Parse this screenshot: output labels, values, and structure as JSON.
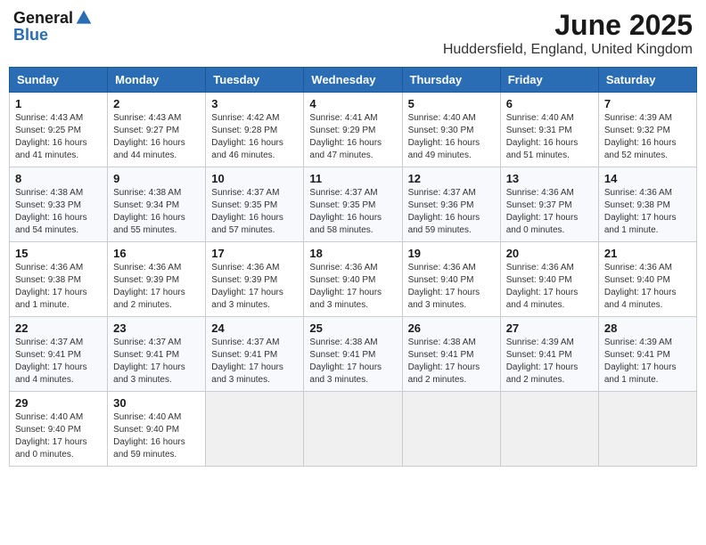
{
  "header": {
    "logo_general": "General",
    "logo_blue": "Blue",
    "month_title": "June 2025",
    "location": "Huddersfield, England, United Kingdom"
  },
  "days_of_week": [
    "Sunday",
    "Monday",
    "Tuesday",
    "Wednesday",
    "Thursday",
    "Friday",
    "Saturday"
  ],
  "weeks": [
    [
      {
        "day": "1",
        "info": "Sunrise: 4:43 AM\nSunset: 9:25 PM\nDaylight: 16 hours and 41 minutes."
      },
      {
        "day": "2",
        "info": "Sunrise: 4:43 AM\nSunset: 9:27 PM\nDaylight: 16 hours and 44 minutes."
      },
      {
        "day": "3",
        "info": "Sunrise: 4:42 AM\nSunset: 9:28 PM\nDaylight: 16 hours and 46 minutes."
      },
      {
        "day": "4",
        "info": "Sunrise: 4:41 AM\nSunset: 9:29 PM\nDaylight: 16 hours and 47 minutes."
      },
      {
        "day": "5",
        "info": "Sunrise: 4:40 AM\nSunset: 9:30 PM\nDaylight: 16 hours and 49 minutes."
      },
      {
        "day": "6",
        "info": "Sunrise: 4:40 AM\nSunset: 9:31 PM\nDaylight: 16 hours and 51 minutes."
      },
      {
        "day": "7",
        "info": "Sunrise: 4:39 AM\nSunset: 9:32 PM\nDaylight: 16 hours and 52 minutes."
      }
    ],
    [
      {
        "day": "8",
        "info": "Sunrise: 4:38 AM\nSunset: 9:33 PM\nDaylight: 16 hours and 54 minutes."
      },
      {
        "day": "9",
        "info": "Sunrise: 4:38 AM\nSunset: 9:34 PM\nDaylight: 16 hours and 55 minutes."
      },
      {
        "day": "10",
        "info": "Sunrise: 4:37 AM\nSunset: 9:35 PM\nDaylight: 16 hours and 57 minutes."
      },
      {
        "day": "11",
        "info": "Sunrise: 4:37 AM\nSunset: 9:35 PM\nDaylight: 16 hours and 58 minutes."
      },
      {
        "day": "12",
        "info": "Sunrise: 4:37 AM\nSunset: 9:36 PM\nDaylight: 16 hours and 59 minutes."
      },
      {
        "day": "13",
        "info": "Sunrise: 4:36 AM\nSunset: 9:37 PM\nDaylight: 17 hours and 0 minutes."
      },
      {
        "day": "14",
        "info": "Sunrise: 4:36 AM\nSunset: 9:38 PM\nDaylight: 17 hours and 1 minute."
      }
    ],
    [
      {
        "day": "15",
        "info": "Sunrise: 4:36 AM\nSunset: 9:38 PM\nDaylight: 17 hours and 1 minute."
      },
      {
        "day": "16",
        "info": "Sunrise: 4:36 AM\nSunset: 9:39 PM\nDaylight: 17 hours and 2 minutes."
      },
      {
        "day": "17",
        "info": "Sunrise: 4:36 AM\nSunset: 9:39 PM\nDaylight: 17 hours and 3 minutes."
      },
      {
        "day": "18",
        "info": "Sunrise: 4:36 AM\nSunset: 9:40 PM\nDaylight: 17 hours and 3 minutes."
      },
      {
        "day": "19",
        "info": "Sunrise: 4:36 AM\nSunset: 9:40 PM\nDaylight: 17 hours and 3 minutes."
      },
      {
        "day": "20",
        "info": "Sunrise: 4:36 AM\nSunset: 9:40 PM\nDaylight: 17 hours and 4 minutes."
      },
      {
        "day": "21",
        "info": "Sunrise: 4:36 AM\nSunset: 9:40 PM\nDaylight: 17 hours and 4 minutes."
      }
    ],
    [
      {
        "day": "22",
        "info": "Sunrise: 4:37 AM\nSunset: 9:41 PM\nDaylight: 17 hours and 4 minutes."
      },
      {
        "day": "23",
        "info": "Sunrise: 4:37 AM\nSunset: 9:41 PM\nDaylight: 17 hours and 3 minutes."
      },
      {
        "day": "24",
        "info": "Sunrise: 4:37 AM\nSunset: 9:41 PM\nDaylight: 17 hours and 3 minutes."
      },
      {
        "day": "25",
        "info": "Sunrise: 4:38 AM\nSunset: 9:41 PM\nDaylight: 17 hours and 3 minutes."
      },
      {
        "day": "26",
        "info": "Sunrise: 4:38 AM\nSunset: 9:41 PM\nDaylight: 17 hours and 2 minutes."
      },
      {
        "day": "27",
        "info": "Sunrise: 4:39 AM\nSunset: 9:41 PM\nDaylight: 17 hours and 2 minutes."
      },
      {
        "day": "28",
        "info": "Sunrise: 4:39 AM\nSunset: 9:41 PM\nDaylight: 17 hours and 1 minute."
      }
    ],
    [
      {
        "day": "29",
        "info": "Sunrise: 4:40 AM\nSunset: 9:40 PM\nDaylight: 17 hours and 0 minutes."
      },
      {
        "day": "30",
        "info": "Sunrise: 4:40 AM\nSunset: 9:40 PM\nDaylight: 16 hours and 59 minutes."
      },
      {
        "day": "",
        "info": ""
      },
      {
        "day": "",
        "info": ""
      },
      {
        "day": "",
        "info": ""
      },
      {
        "day": "",
        "info": ""
      },
      {
        "day": "",
        "info": ""
      }
    ]
  ]
}
